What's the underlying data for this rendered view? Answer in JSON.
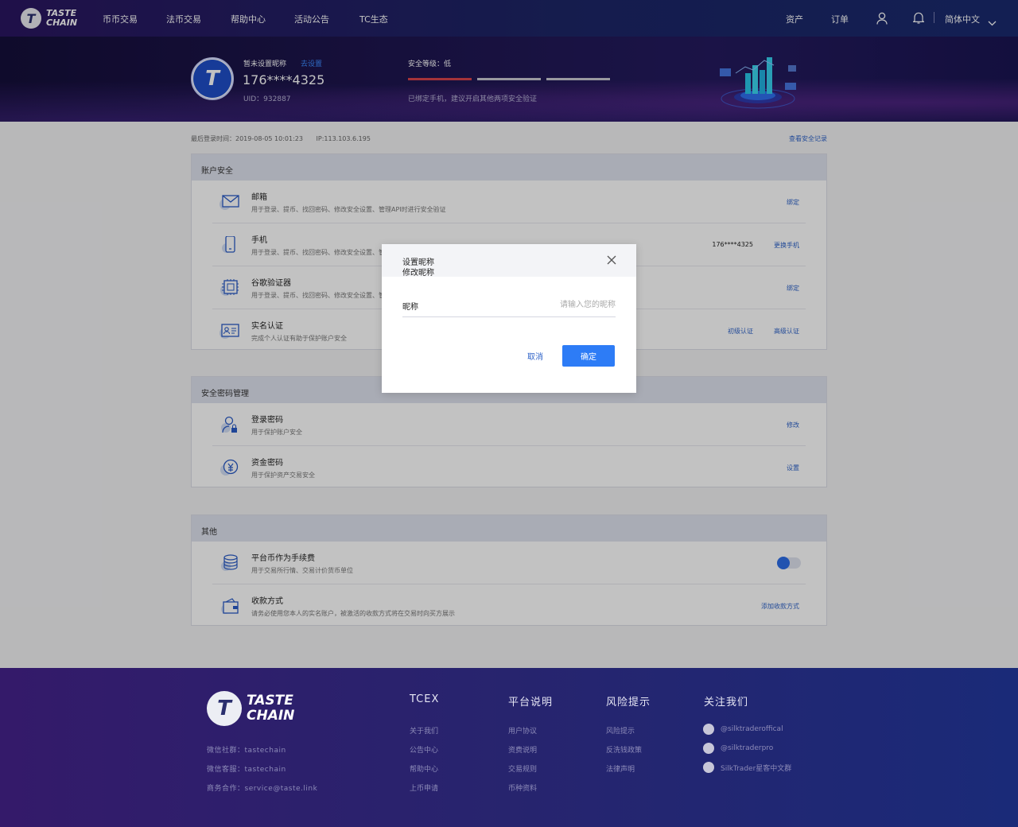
{
  "nav": {
    "logo_line1": "TASTE",
    "logo_line2": "CHAIN",
    "logo_mark": "T",
    "items": [
      "币币交易",
      "法币交易",
      "帮助中心",
      "活动公告",
      "TC生态"
    ],
    "assets": "资产",
    "orders": "订单",
    "language": "简体中文",
    "icons": [
      "user-icon",
      "bell-icon",
      "chevron-down-icon"
    ]
  },
  "profile": {
    "avatar_mark": "T",
    "nickname": "暂未设置昵称",
    "set_link": "去设置",
    "phone": "176****4325",
    "uid": "UID：932887",
    "security_label": "安全等级：低",
    "security_level_fraction": 0.33,
    "security_note": "已绑定手机，建议开启其他两项安全验证",
    "colors": {
      "bar_active": "#d9434b",
      "bar_inactive": "#c9c9d3"
    }
  },
  "meta": {
    "last_login": "最后登录时间：2019-08-05 10:01:23",
    "ip": "IP:113.103.6.195",
    "security_log": "查看安全记录"
  },
  "account_security": {
    "title": "账户安全",
    "rows": [
      {
        "icon": "mail-icon",
        "title": "邮箱",
        "desc": "用于登录、提币、找回密码、修改安全设置、管理API时进行安全验证",
        "action": "绑定"
      },
      {
        "icon": "phone-icon",
        "title": "手机",
        "desc": "用于登录、提币、找回密码、修改安全设置、管",
        "value": "176****4325",
        "action": "更换手机"
      },
      {
        "icon": "chip-icon",
        "title": "谷歌验证器",
        "desc": "用于登录、提币、找回密码、修改安全设置、管",
        "action": "绑定"
      },
      {
        "icon": "id-card-icon",
        "title": "实名认证",
        "desc": "完成个人认证有助于保护账户安全",
        "action_primary": "初级认证",
        "action": "高级认证"
      }
    ]
  },
  "password_mgmt": {
    "title": "安全密码管理",
    "rows": [
      {
        "icon": "user-lock-icon",
        "title": "登录密码",
        "desc": "用于保护账户安全",
        "action": "修改"
      },
      {
        "icon": "yuan-coin-icon",
        "title": "资金密码",
        "desc": "用于保护资产交易安全",
        "action": "设置"
      }
    ]
  },
  "other": {
    "title": "其他",
    "rows": [
      {
        "icon": "coins-icon",
        "title": "平台币作为手续费",
        "desc": "用于交易所行情、交易计价货币单位",
        "toggle_on": true
      },
      {
        "icon": "wallet-icon",
        "title": "收款方式",
        "desc": "请务必使用您本人的实名账户，被激活的收款方式将在交易时向买方展示",
        "action": "添加收款方式"
      }
    ]
  },
  "modal": {
    "title_line1": "设置昵称",
    "title_line2": "修改昵称",
    "field_label": "昵称",
    "field_value": "",
    "field_placeholder": "请输入您的昵称",
    "cancel": "取消",
    "confirm": "确定",
    "accent": "#2d7cf6"
  },
  "footer": {
    "logo_mark": "T",
    "logo_line1": "TASTE",
    "logo_line2": "CHAIN",
    "contacts": [
      "微信社群：tastechain",
      "微信客服：tastechain",
      "商务合作：service@taste.link"
    ],
    "columns": [
      {
        "title": "TCEX",
        "items": [
          "关于我们",
          "公告中心",
          "帮助中心",
          "上币申请"
        ]
      },
      {
        "title": "平台说明",
        "items": [
          "用户协议",
          "资费说明",
          "交易规则",
          "币种资料"
        ]
      },
      {
        "title": "风险提示",
        "items": [
          "风险提示",
          "反洗钱政策",
          "法律声明"
        ]
      },
      {
        "title": "关注我们",
        "items": [
          "@silktraderoffical",
          "@silktraderpro",
          "SilkTrader星客中文群"
        ]
      }
    ]
  }
}
